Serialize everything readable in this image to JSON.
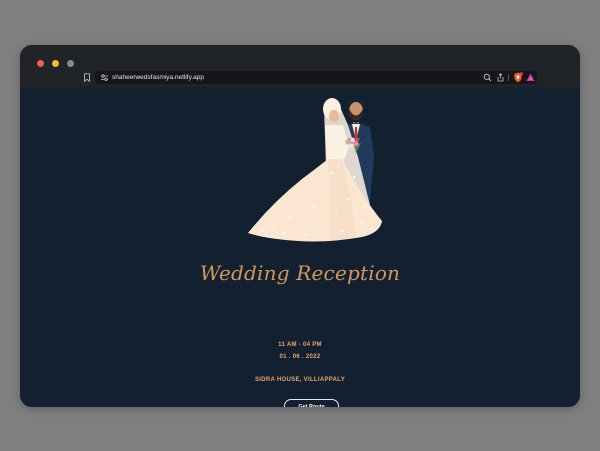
{
  "browser": {
    "url": "shaheerwedsfasmiya.netlify.app",
    "icons": [
      "bookmark-icon",
      "site-settings-icon",
      "zoom-icon",
      "share-icon",
      "brave-shield-icon",
      "brave-rewards-icon"
    ]
  },
  "invitation": {
    "title": "Wedding Reception",
    "time": "11 AM - 04 PM",
    "date": "01 . 06 . 2022",
    "venue": "SIDRA HOUSE, VILLIAPPALY",
    "route_button": "Get Route"
  },
  "colors": {
    "page_background": "#132030",
    "accent": "#d3975c",
    "chrome": "#212426"
  }
}
